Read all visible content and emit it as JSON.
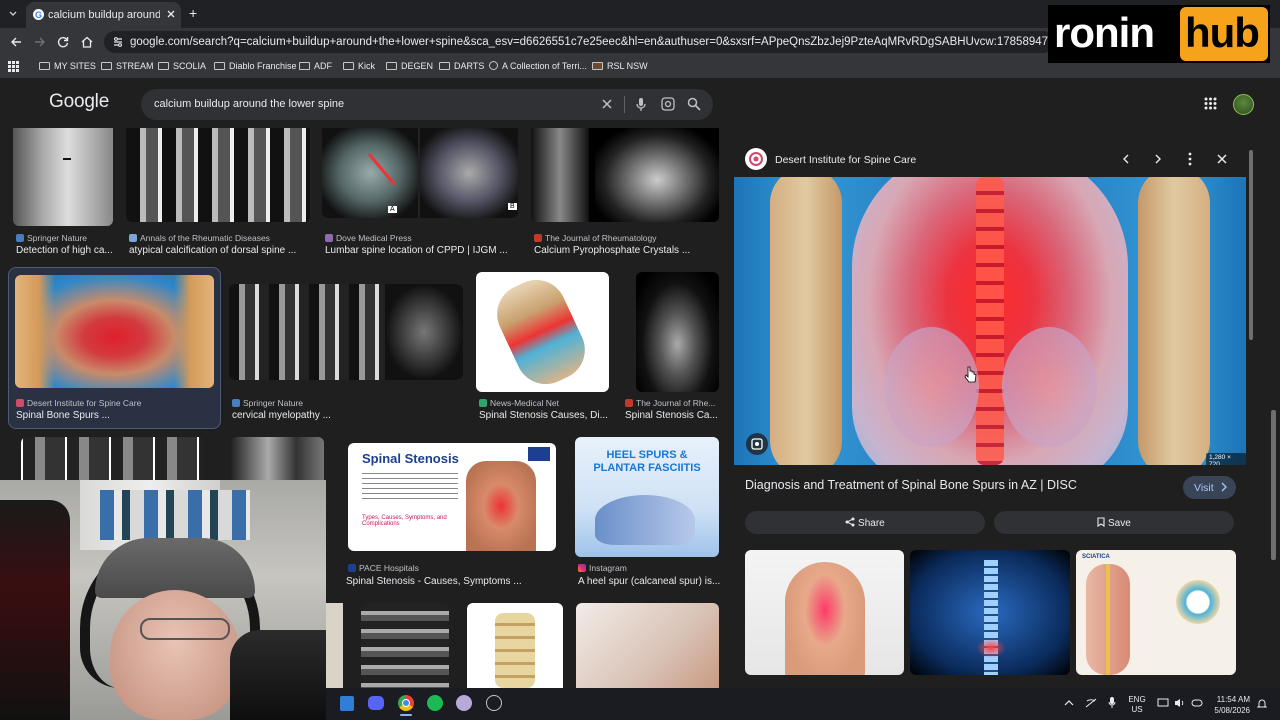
{
  "browser": {
    "tab_title": "calcium buildup around the lowe",
    "new_tab_symbol": "+",
    "url": "google.com/search?q=calcium+buildup+around+the+lower+spine&sca_esv=d6626551c7e25eec&hl=en&authuser=0&sxsrf=APpeQnsZbzJej9PzteAqMRvRDgSABHUvcw:1785894761947&source=hp&biw=1920&bih=911&e",
    "bookmarks": [
      "MY SITES",
      "STREAM",
      "SCOLIA",
      "Diablo Franchise",
      "ADF",
      "Kick",
      "DEGEN",
      "DARTS",
      "A Collection of Terri...",
      "RSL NSW"
    ]
  },
  "google": {
    "logo": "Google",
    "query": "calcium buildup around the lower spine"
  },
  "results": [
    {
      "source": "Springer Nature",
      "caption": "Detection of high ca..."
    },
    {
      "source": "Annals of the Rheumatic Diseases",
      "caption": "atypical calcification of dorsal spine ..."
    },
    {
      "source": "Dove Medical Press",
      "caption": "Lumbar spine location of CPPD | IJGM ..."
    },
    {
      "source": "The Journal of Rheumatology",
      "caption": "Calcium Pyrophosphate Crystals ..."
    },
    {
      "source": "Desert Institute for Spine Care",
      "caption": "Spinal Bone Spurs ..."
    },
    {
      "source": "Springer Nature",
      "caption": "cervical myelopathy ..."
    },
    {
      "source": "News-Medical Net",
      "caption": "Spinal Stenosis Causes, Di..."
    },
    {
      "source": "The Journal of Rhe...",
      "caption": "Spinal Stenosis Ca..."
    },
    {
      "source": "PACE Hospitals",
      "caption": "Spinal Stenosis - Causes, Symptoms ..."
    },
    {
      "source": "Instagram",
      "caption": "A heel spur (calcaneal spur) is..."
    }
  ],
  "thumb_text": {
    "label_a": "A",
    "label_b": "B",
    "stenosis_title": "Spinal Stenosis",
    "stenosis_sub": "Types, Causes, Symptoms, and Complications",
    "heel_title": "HEEL SPURS & PLANTAR FASCIITIS",
    "sciatica": "SCIATICA"
  },
  "panel": {
    "source": "Desert Institute for Spine Care",
    "image_size": "1,280 × 720",
    "title": "Diagnosis and Treatment of Spinal Bone Spurs in AZ | DISC",
    "visit_label": "Visit",
    "share_label": "Share",
    "save_label": "Save"
  },
  "overlay": {
    "brand_left": "ronin",
    "brand_right": "hub"
  },
  "taskbar": {
    "lang": "ENG",
    "region": "US",
    "time": "11:54 AM",
    "date": "5/08/2026"
  },
  "colors": {
    "accent_blue": "#8ab4f8",
    "ronin_orange": "#f7a21b",
    "panel_bg": "#1f1f1f"
  }
}
